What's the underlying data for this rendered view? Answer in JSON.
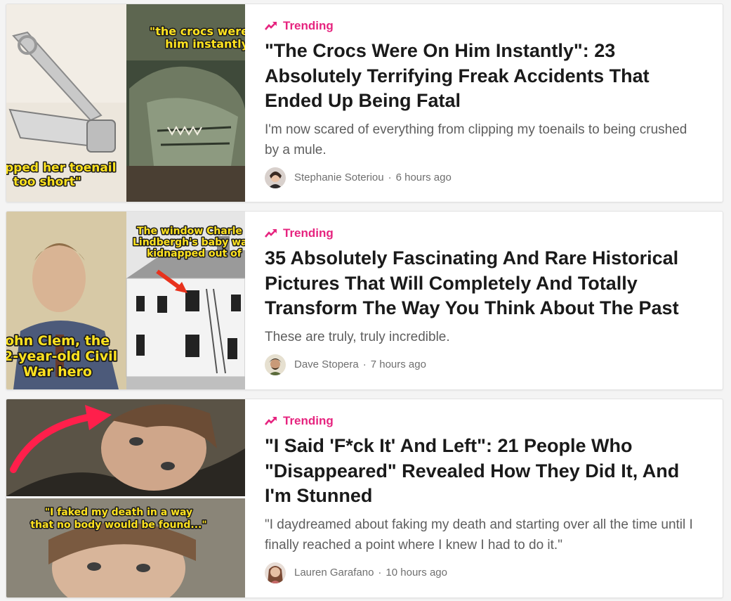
{
  "colors": {
    "accent": "#e6247f",
    "background": "#f4f4f4",
    "card": "#ffffff"
  },
  "articles": [
    {
      "badge_icon": "trending-arrow-icon",
      "badge": "Trending",
      "title": "\"The Crocs Were On Him Instantly\": 23 Absolutely Terrifying Freak Accidents That Ended Up Being Fatal",
      "description": "I'm now scared of everything from clipping my toenails to being crushed by a mule.",
      "author": "Stephanie Soteriou",
      "time": "6 hours ago",
      "thumb_captions": [
        "\"the crocs were",
        "him instantly",
        "pped her toenail",
        "too short\""
      ]
    },
    {
      "badge_icon": "trending-arrow-icon",
      "badge": "Trending",
      "title": "35 Absolutely Fascinating And Rare Historical Pictures That Will Completely And Totally Transform The Way You Think About The Past",
      "description": "These are truly, truly incredible.",
      "author": "Dave Stopera",
      "time": "7 hours ago",
      "thumb_captions": [
        "The window Charle",
        "Lindbergh's baby wa",
        "kidnapped out of",
        "ohn Clem, the",
        "2-year-old Civil",
        "War hero"
      ]
    },
    {
      "badge_icon": "trending-arrow-icon",
      "badge": "Trending",
      "title": "\"I Said 'F*ck It' And Left\": 21 People Who \"Disappeared\" Revealed How They Did It, And I'm Stunned",
      "description": "\"I daydreamed about faking my death and starting over all the time until I finally reached a point where I knew I had to do it.\"",
      "author": "Lauren Garafano",
      "time": "10 hours ago",
      "thumb_captions": [
        "\"I faked my death in a way",
        "that no body would be found...\""
      ]
    }
  ]
}
